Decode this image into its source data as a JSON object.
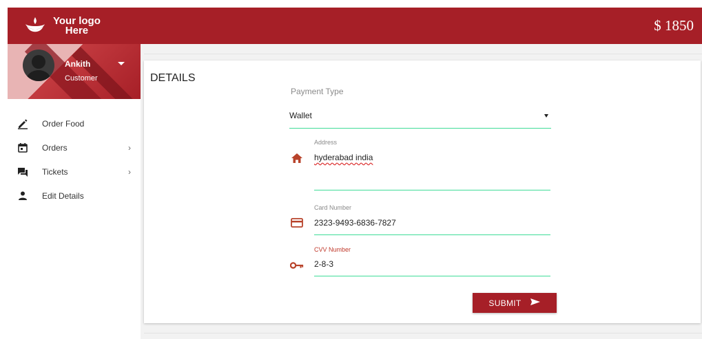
{
  "header": {
    "logo_line1": "Your logo",
    "logo_line2": "Here",
    "balance": "$ 1850"
  },
  "profile": {
    "name": "Ankith",
    "role": "Customer"
  },
  "menu": [
    {
      "label": "Order Food",
      "icon": "pencil-icon"
    },
    {
      "label": "Orders",
      "icon": "calendar-icon",
      "arrow": "›"
    },
    {
      "label": "Tickets",
      "icon": "chat-icon",
      "arrow": "›"
    },
    {
      "label": "Edit Details",
      "icon": "person-icon"
    }
  ],
  "details": {
    "title": "DETAILS",
    "payment_type_label": "Payment Type",
    "payment_type_value": "Wallet",
    "address_label": "Address",
    "address_value": "hyderabad india",
    "card_label": "Card Number",
    "card_value": "2323-9493-6836-7827",
    "cvv_label": "CVV Number",
    "cvv_value": "2-8-3",
    "submit_label": "SUBMIT"
  },
  "colors": {
    "brand": "#a61f27",
    "accent_line": "#3ddc97",
    "icon": "#b8432b"
  }
}
